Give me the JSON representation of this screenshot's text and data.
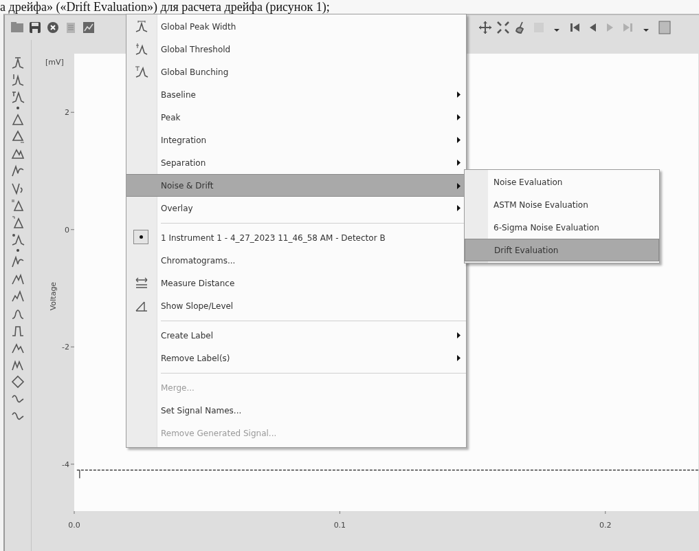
{
  "document_caption": "а дрейфа» («Drift Evaluation») для расчета дрейфа (рисунок 1);",
  "chart": {
    "y_unit": "[mV]",
    "chart_data": {
      "type": "line",
      "ylabel": "Voltage",
      "xlim": [
        0,
        0.235
      ],
      "ylim": [
        -4.8,
        3
      ],
      "xticks": [
        {
          "value": 0,
          "label": "0.0"
        },
        {
          "value": 0.1,
          "label": "0.1"
        },
        {
          "value": 0.2,
          "label": "0.2"
        }
      ],
      "yticks": [
        2,
        0,
        -2,
        -4
      ],
      "series": [
        {
          "color": "#222222",
          "line_style": "dashed",
          "x": [
            0.001,
            0.235
          ],
          "values": [
            -4.1,
            -4.1
          ]
        }
      ]
    }
  },
  "context_menu": {
    "items": [
      {
        "kind": "command",
        "label": "Global Peak Width",
        "selected": false,
        "disabled": false
      },
      {
        "kind": "command",
        "label": "Global Threshold",
        "selected": false,
        "disabled": false
      },
      {
        "kind": "command",
        "label": "Global Bunching",
        "selected": false,
        "disabled": false
      },
      {
        "kind": "submenu",
        "label": "Baseline",
        "selected": false,
        "disabled": false
      },
      {
        "kind": "submenu",
        "label": "Peak",
        "selected": false,
        "disabled": false
      },
      {
        "kind": "submenu",
        "label": "Integration",
        "selected": false,
        "disabled": false
      },
      {
        "kind": "submenu",
        "label": "Separation",
        "selected": false,
        "disabled": false
      },
      {
        "kind": "submenu",
        "label": "Noise & Drift",
        "selected": true,
        "disabled": false
      },
      {
        "kind": "submenu",
        "label": "Overlay",
        "selected": false,
        "disabled": false
      },
      {
        "kind": "separator"
      },
      {
        "kind": "radio",
        "label": "1 Instrument 1 - 4_27_2023 11_46_58 AM - Detector B",
        "selected": false,
        "disabled": false,
        "checked": true
      },
      {
        "kind": "command",
        "label": "Chromatograms...",
        "selected": false,
        "disabled": false
      },
      {
        "kind": "command",
        "label": "Measure Distance",
        "selected": false,
        "disabled": false
      },
      {
        "kind": "command",
        "label": "Show Slope/Level",
        "selected": false,
        "disabled": false
      },
      {
        "kind": "separator"
      },
      {
        "kind": "submenu",
        "label": "Create Label",
        "selected": false,
        "disabled": false
      },
      {
        "kind": "submenu",
        "label": "Remove Label(s)",
        "selected": false,
        "disabled": false
      },
      {
        "kind": "separator"
      },
      {
        "kind": "command",
        "label": "Merge...",
        "selected": false,
        "disabled": true
      },
      {
        "kind": "command",
        "label": "Set Signal Names...",
        "selected": false,
        "disabled": false
      },
      {
        "kind": "command",
        "label": "Remove Generated Signal...",
        "selected": false,
        "disabled": true
      }
    ]
  },
  "submenu": {
    "items": [
      {
        "label": "Noise Evaluation",
        "selected": false
      },
      {
        "label": "ASTM Noise Evaluation",
        "selected": false
      },
      {
        "label": "6-Sigma Noise Evaluation",
        "selected": false
      },
      {
        "label": "Drift Evaluation",
        "selected": true
      }
    ]
  }
}
